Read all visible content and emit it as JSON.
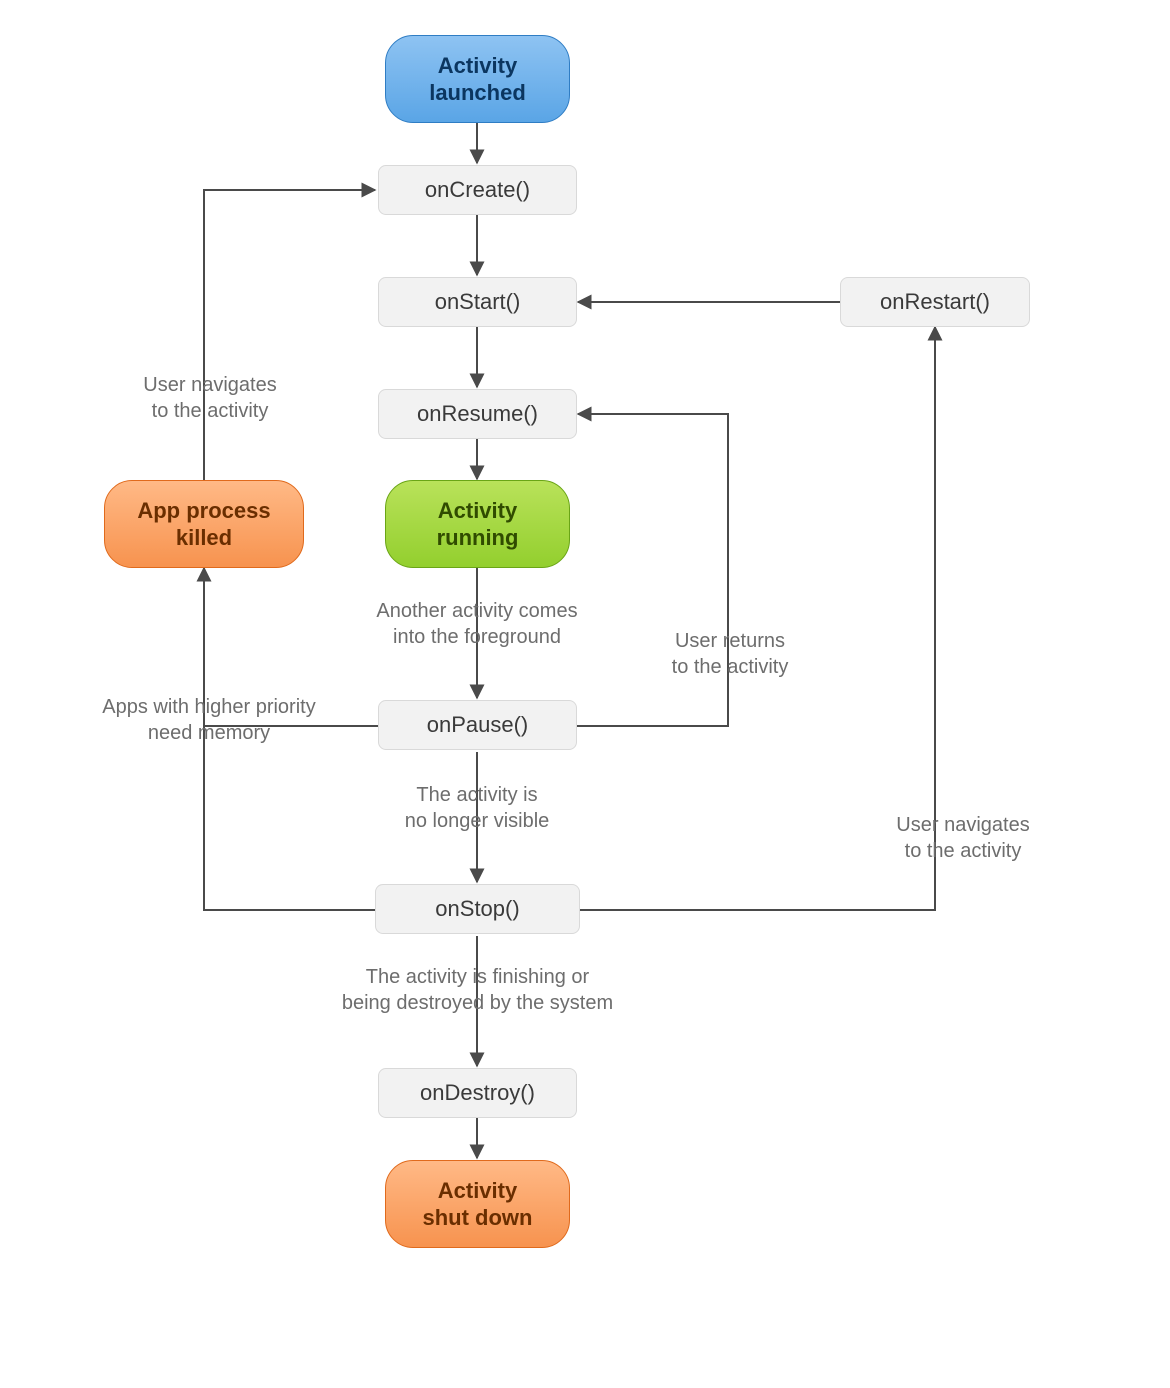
{
  "nodes": {
    "launched": {
      "l1": "Activity",
      "l2": "launched"
    },
    "onCreate": "onCreate()",
    "onStart": "onStart()",
    "onResume": "onResume()",
    "running": {
      "l1": "Activity",
      "l2": "running"
    },
    "onPause": "onPause()",
    "onStop": "onStop()",
    "onDestroy": "onDestroy()",
    "shutdown": {
      "l1": "Activity",
      "l2": "shut down"
    },
    "onRestart": "onRestart()",
    "killed": {
      "l1": "App process",
      "l2": "killed"
    }
  },
  "labels": {
    "foreground": {
      "l1": "Another activity comes",
      "l2": "into the foreground"
    },
    "notVisible": {
      "l1": "The activity is",
      "l2": "no longer visible"
    },
    "finishing": {
      "l1": "The activity is finishing or",
      "l2": "being destroyed by the system"
    },
    "userReturnsResume": {
      "l1": "User returns",
      "l2": "to the activity"
    },
    "userNavRestart": {
      "l1": "User navigates",
      "l2": "to the activity"
    },
    "userNavKilled": {
      "l1": "User navigates",
      "l2": "to the activity"
    },
    "needMemory": {
      "l1": "Apps with higher priority",
      "l2": "need memory"
    }
  },
  "colors": {
    "blue": "#5aa5e6",
    "green": "#93cf2e",
    "orange": "#f7934f",
    "box": "#f2f2f2"
  },
  "chart_data": {
    "type": "flowchart",
    "title": "Android Activity lifecycle",
    "nodes": [
      {
        "id": "launched",
        "label": "Activity launched",
        "kind": "state"
      },
      {
        "id": "onCreate",
        "label": "onCreate()",
        "kind": "method"
      },
      {
        "id": "onStart",
        "label": "onStart()",
        "kind": "method"
      },
      {
        "id": "onResume",
        "label": "onResume()",
        "kind": "method"
      },
      {
        "id": "running",
        "label": "Activity running",
        "kind": "state"
      },
      {
        "id": "onPause",
        "label": "onPause()",
        "kind": "method"
      },
      {
        "id": "onStop",
        "label": "onStop()",
        "kind": "method"
      },
      {
        "id": "onDestroy",
        "label": "onDestroy()",
        "kind": "method"
      },
      {
        "id": "shutdown",
        "label": "Activity shut down",
        "kind": "state"
      },
      {
        "id": "onRestart",
        "label": "onRestart()",
        "kind": "method"
      },
      {
        "id": "killed",
        "label": "App process killed",
        "kind": "state"
      }
    ],
    "edges": [
      {
        "from": "launched",
        "to": "onCreate"
      },
      {
        "from": "onCreate",
        "to": "onStart"
      },
      {
        "from": "onStart",
        "to": "onResume"
      },
      {
        "from": "onResume",
        "to": "running"
      },
      {
        "from": "running",
        "to": "onPause",
        "label": "Another activity comes into the foreground"
      },
      {
        "from": "onPause",
        "to": "onResume",
        "label": "User returns to the activity"
      },
      {
        "from": "onPause",
        "to": "onStop",
        "label": "The activity is no longer visible"
      },
      {
        "from": "onStop",
        "to": "onRestart",
        "label": "User navigates to the activity"
      },
      {
        "from": "onRestart",
        "to": "onStart"
      },
      {
        "from": "onStop",
        "to": "onDestroy",
        "label": "The activity is finishing or being destroyed by the system"
      },
      {
        "from": "onDestroy",
        "to": "shutdown"
      },
      {
        "from": "onPause",
        "to": "killed",
        "label": "Apps with higher priority need memory"
      },
      {
        "from": "onStop",
        "to": "killed",
        "label": "Apps with higher priority need memory"
      },
      {
        "from": "killed",
        "to": "onCreate",
        "label": "User navigates to the activity"
      }
    ]
  }
}
